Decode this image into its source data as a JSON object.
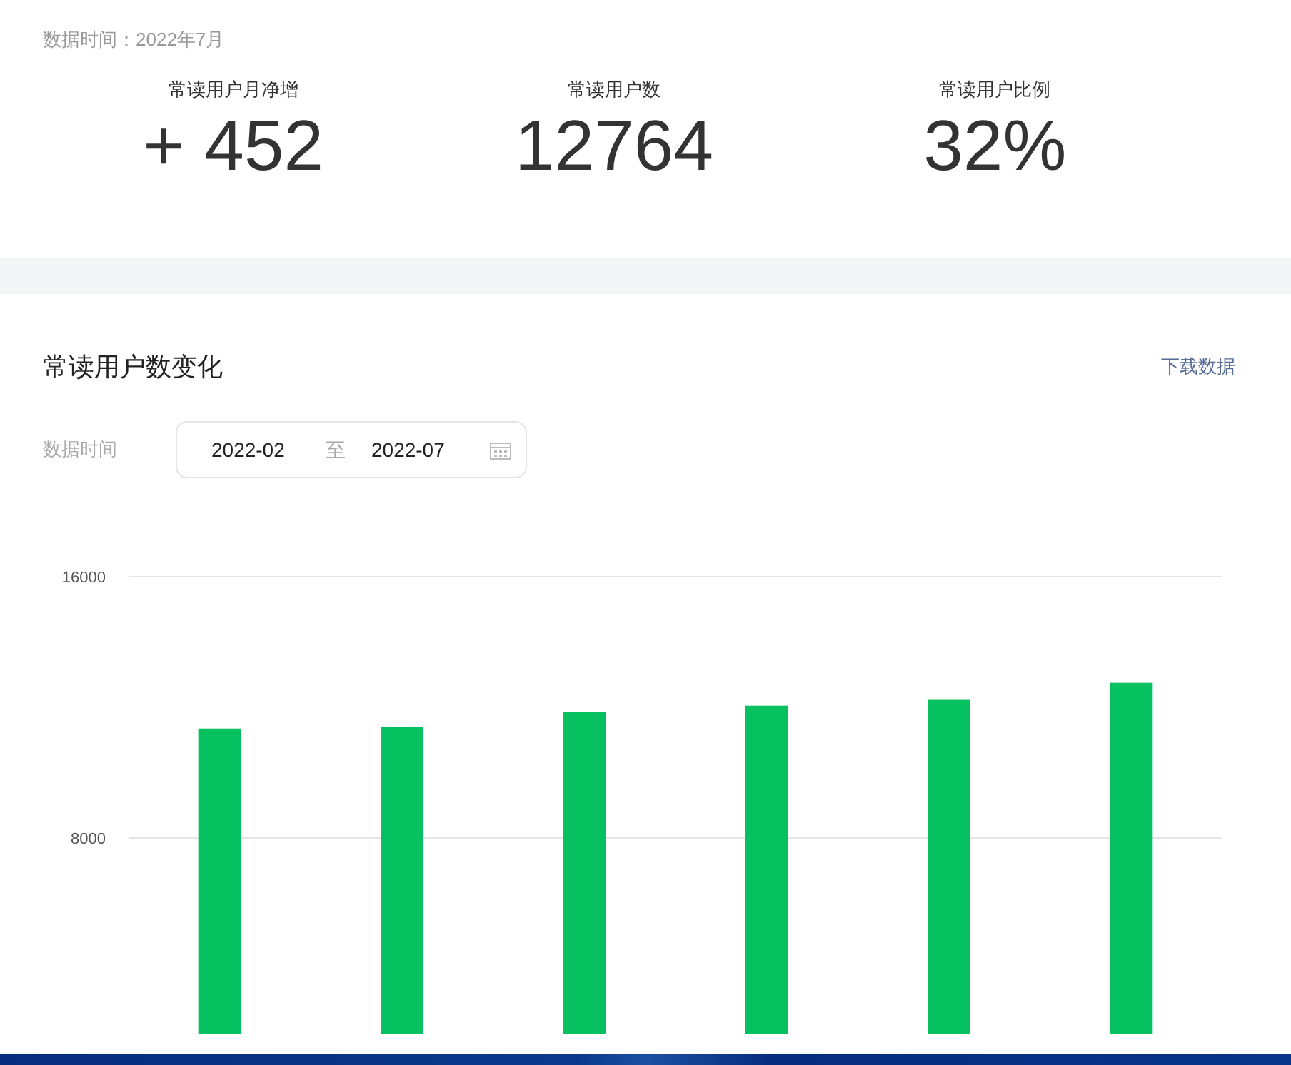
{
  "data_time": "数据时间：2022年7月",
  "stats": [
    {
      "label": "常读用户月净增",
      "value": "+ 452"
    },
    {
      "label": "常读用户数",
      "value": "12764"
    },
    {
      "label": "常读用户比例",
      "value": "32%"
    }
  ],
  "trend": {
    "title": "常读用户数变化",
    "download_link": "下载数据",
    "filter_label": "数据时间",
    "range": {
      "start": "2022-02",
      "separator": "至",
      "end": "2022-07"
    },
    "chart_data": {
      "type": "bar",
      "series": [
        {
          "color": "#07c160",
          "values": [
            11350,
            11400,
            11850,
            12050,
            12250,
            12750
          ]
        }
      ],
      "ylim": [
        2000,
        16000
      ],
      "yticks": [
        8000,
        16000
      ]
    }
  }
}
